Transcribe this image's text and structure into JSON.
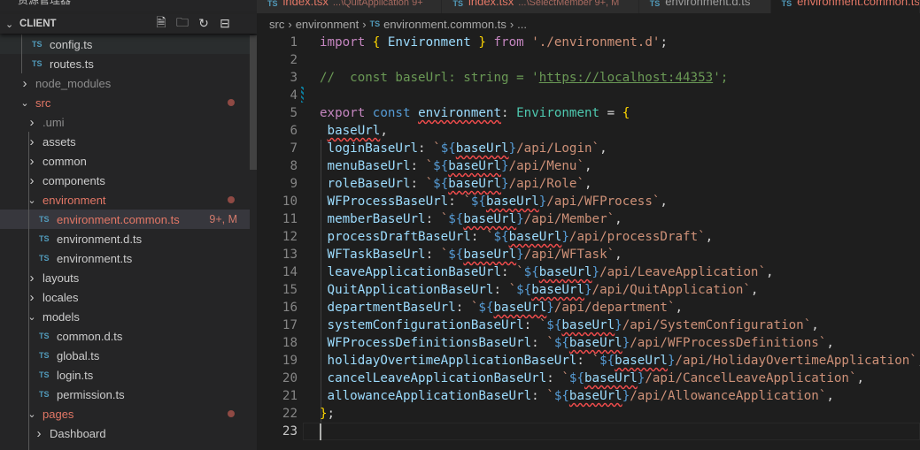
{
  "sidebar": {
    "title": "资源管理器",
    "section": "CLIENT",
    "items": [
      {
        "label": "config.ts",
        "type": "ts",
        "indent": 1,
        "hl": true
      },
      {
        "label": "routes.ts",
        "type": "ts",
        "indent": 1
      },
      {
        "label": "node_modules",
        "type": "folder",
        "open": false,
        "indent": 0,
        "dim": true
      },
      {
        "label": "src",
        "type": "folder",
        "open": true,
        "indent": 0,
        "mod": true,
        "dot": true
      },
      {
        "label": ".umi",
        "type": "folder",
        "open": false,
        "indent": 1,
        "dim": true
      },
      {
        "label": "assets",
        "type": "folder",
        "open": false,
        "indent": 1
      },
      {
        "label": "common",
        "type": "folder",
        "open": false,
        "indent": 1
      },
      {
        "label": "components",
        "type": "folder",
        "open": false,
        "indent": 1
      },
      {
        "label": "environment",
        "type": "folder",
        "open": true,
        "indent": 1,
        "mod": true,
        "dot": true
      },
      {
        "label": "environment.common.ts",
        "type": "ts",
        "indent": 2,
        "mod": true,
        "sel": true,
        "badge": "9+, M"
      },
      {
        "label": "environment.d.ts",
        "type": "ts",
        "indent": 2
      },
      {
        "label": "environment.ts",
        "type": "ts",
        "indent": 2
      },
      {
        "label": "layouts",
        "type": "folder",
        "open": false,
        "indent": 1
      },
      {
        "label": "locales",
        "type": "folder",
        "open": false,
        "indent": 1
      },
      {
        "label": "models",
        "type": "folder",
        "open": true,
        "indent": 1
      },
      {
        "label": "common.d.ts",
        "type": "ts",
        "indent": 2
      },
      {
        "label": "global.ts",
        "type": "ts",
        "indent": 2
      },
      {
        "label": "login.ts",
        "type": "ts",
        "indent": 2
      },
      {
        "label": "permission.ts",
        "type": "ts",
        "indent": 2
      },
      {
        "label": "pages",
        "type": "folder",
        "open": true,
        "indent": 1,
        "mod": true,
        "dot": true
      },
      {
        "label": "Dashboard",
        "type": "folder",
        "open": false,
        "indent": 2
      }
    ]
  },
  "tabs": [
    {
      "label": "index.tsx",
      "desc": "...\\QuitApplication 9+",
      "style": "mod"
    },
    {
      "label": "index.tsx",
      "desc": "...\\SelectMember 9+, M",
      "style": "mod"
    },
    {
      "label": "environment.d.ts",
      "desc": "",
      "style": "plain"
    },
    {
      "label": "environment.common.ts",
      "desc": "",
      "style": "act"
    }
  ],
  "breadcrumb": [
    "src",
    "environment",
    "environment.common.ts",
    "..."
  ],
  "current_line": 23,
  "code": [
    [
      [
        "kw",
        "import"
      ],
      [
        "p",
        " "
      ],
      [
        "b1",
        "{"
      ],
      [
        "p",
        " "
      ],
      [
        "v",
        "Environment"
      ],
      [
        "p",
        " "
      ],
      [
        "b1",
        "}"
      ],
      [
        "p",
        " "
      ],
      [
        "kw",
        "from"
      ],
      [
        "p",
        " "
      ],
      [
        "s",
        "'./environment.d'"
      ],
      [
        "p",
        ";"
      ]
    ],
    [],
    [
      [
        "cm",
        "//  const baseUrl: string = '"
      ],
      [
        "cmu",
        "https://localhost:44353"
      ],
      [
        "cm",
        "';"
      ]
    ],
    [],
    [
      [
        "kw",
        "export"
      ],
      [
        "p",
        " "
      ],
      [
        "st",
        "const"
      ],
      [
        "p",
        " "
      ],
      [
        "v sq",
        "environment"
      ],
      [
        "p",
        ": "
      ],
      [
        "ty",
        "Environment"
      ],
      [
        "p",
        " = "
      ],
      [
        "b1",
        "{"
      ]
    ],
    [
      [
        "p",
        " "
      ],
      [
        "v sq",
        "baseUrl"
      ],
      [
        "p",
        ","
      ]
    ],
    [
      [
        "p",
        " "
      ],
      [
        "v",
        "loginBaseUrl"
      ],
      [
        "p",
        ": "
      ],
      [
        "s",
        "`"
      ],
      [
        "st",
        "${"
      ],
      [
        "v sq",
        "baseUrl"
      ],
      [
        "st",
        "}"
      ],
      [
        "s",
        "/api/Login`"
      ],
      [
        "p",
        ","
      ]
    ],
    [
      [
        "p",
        " "
      ],
      [
        "v",
        "menuBaseUrl"
      ],
      [
        "p",
        ": "
      ],
      [
        "s",
        "`"
      ],
      [
        "st",
        "${"
      ],
      [
        "v sq",
        "baseUrl"
      ],
      [
        "st",
        "}"
      ],
      [
        "s",
        "/api/Menu`"
      ],
      [
        "p",
        ","
      ]
    ],
    [
      [
        "p",
        " "
      ],
      [
        "v",
        "roleBaseUrl"
      ],
      [
        "p",
        ": "
      ],
      [
        "s",
        "`"
      ],
      [
        "st",
        "${"
      ],
      [
        "v sq",
        "baseUrl"
      ],
      [
        "st",
        "}"
      ],
      [
        "s",
        "/api/Role`"
      ],
      [
        "p",
        ","
      ]
    ],
    [
      [
        "p",
        " "
      ],
      [
        "v",
        "WFProcessBaseUrl"
      ],
      [
        "p",
        ": "
      ],
      [
        "s",
        "`"
      ],
      [
        "st",
        "${"
      ],
      [
        "v sq",
        "baseUrl"
      ],
      [
        "st",
        "}"
      ],
      [
        "s",
        "/api/WFProcess`"
      ],
      [
        "p",
        ","
      ]
    ],
    [
      [
        "p",
        " "
      ],
      [
        "v",
        "memberBaseUrl"
      ],
      [
        "p",
        ": "
      ],
      [
        "s",
        "`"
      ],
      [
        "st",
        "${"
      ],
      [
        "v sq",
        "baseUrl"
      ],
      [
        "st",
        "}"
      ],
      [
        "s",
        "/api/Member`"
      ],
      [
        "p",
        ","
      ]
    ],
    [
      [
        "p",
        " "
      ],
      [
        "v",
        "processDraftBaseUrl"
      ],
      [
        "p",
        ": "
      ],
      [
        "s",
        "`"
      ],
      [
        "st",
        "${"
      ],
      [
        "v sq",
        "baseUrl"
      ],
      [
        "st",
        "}"
      ],
      [
        "s",
        "/api/processDraft`"
      ],
      [
        "p",
        ","
      ]
    ],
    [
      [
        "p",
        " "
      ],
      [
        "v",
        "WFTaskBaseUrl"
      ],
      [
        "p",
        ": "
      ],
      [
        "s",
        "`"
      ],
      [
        "st",
        "${"
      ],
      [
        "v sq",
        "baseUrl"
      ],
      [
        "st",
        "}"
      ],
      [
        "s",
        "/api/WFTask`"
      ],
      [
        "p",
        ","
      ]
    ],
    [
      [
        "p",
        " "
      ],
      [
        "v",
        "leaveApplicationBaseUrl"
      ],
      [
        "p",
        ": "
      ],
      [
        "s",
        "`"
      ],
      [
        "st",
        "${"
      ],
      [
        "v sq",
        "baseUrl"
      ],
      [
        "st",
        "}"
      ],
      [
        "s",
        "/api/LeaveApplication`"
      ],
      [
        "p",
        ","
      ]
    ],
    [
      [
        "p",
        " "
      ],
      [
        "v",
        "QuitApplicationBaseUrl"
      ],
      [
        "p",
        ": "
      ],
      [
        "s",
        "`"
      ],
      [
        "st",
        "${"
      ],
      [
        "v sq",
        "baseUrl"
      ],
      [
        "st",
        "}"
      ],
      [
        "s",
        "/api/QuitApplication`"
      ],
      [
        "p",
        ","
      ]
    ],
    [
      [
        "p",
        " "
      ],
      [
        "v",
        "departmentBaseUrl"
      ],
      [
        "p",
        ": "
      ],
      [
        "s",
        "`"
      ],
      [
        "st",
        "${"
      ],
      [
        "v sq",
        "baseUrl"
      ],
      [
        "st",
        "}"
      ],
      [
        "s",
        "/api/department`"
      ],
      [
        "p",
        ","
      ]
    ],
    [
      [
        "p",
        " "
      ],
      [
        "v",
        "systemConfigurationBaseUrl"
      ],
      [
        "p",
        ": "
      ],
      [
        "s",
        "`"
      ],
      [
        "st",
        "${"
      ],
      [
        "v sq",
        "baseUrl"
      ],
      [
        "st",
        "}"
      ],
      [
        "s",
        "/api/SystemConfiguration`"
      ],
      [
        "p",
        ","
      ]
    ],
    [
      [
        "p",
        " "
      ],
      [
        "v",
        "WFProcessDefinitionsBaseUrl"
      ],
      [
        "p",
        ": "
      ],
      [
        "s",
        "`"
      ],
      [
        "st",
        "${"
      ],
      [
        "v sq",
        "baseUrl"
      ],
      [
        "st",
        "}"
      ],
      [
        "s",
        "/api/WFProcessDefinitions`"
      ],
      [
        "p",
        ","
      ]
    ],
    [
      [
        "p",
        " "
      ],
      [
        "v",
        "holidayOvertimeApplicationBaseUrl"
      ],
      [
        "p",
        ": "
      ],
      [
        "s",
        "`"
      ],
      [
        "st",
        "${"
      ],
      [
        "v sq",
        "baseUrl"
      ],
      [
        "st",
        "}"
      ],
      [
        "s",
        "/api/HolidayOvertimeApplication`"
      ],
      [
        "p",
        ","
      ]
    ],
    [
      [
        "p",
        " "
      ],
      [
        "v",
        "cancelLeaveApplicationBaseUrl"
      ],
      [
        "p",
        ": "
      ],
      [
        "s",
        "`"
      ],
      [
        "st",
        "${"
      ],
      [
        "v sq",
        "baseUrl"
      ],
      [
        "st",
        "}"
      ],
      [
        "s",
        "/api/CancelLeaveApplication`"
      ],
      [
        "p",
        ","
      ]
    ],
    [
      [
        "p",
        " "
      ],
      [
        "v",
        "allowanceApplicationBaseUrl"
      ],
      [
        "p",
        ": "
      ],
      [
        "s",
        "`"
      ],
      [
        "st",
        "${"
      ],
      [
        "v sq",
        "baseUrl"
      ],
      [
        "st",
        "}"
      ],
      [
        "s",
        "/api/AllowanceApplication`"
      ],
      [
        "p",
        ","
      ]
    ],
    [
      [
        "b1",
        "}"
      ],
      [
        "p",
        ";"
      ]
    ],
    []
  ]
}
